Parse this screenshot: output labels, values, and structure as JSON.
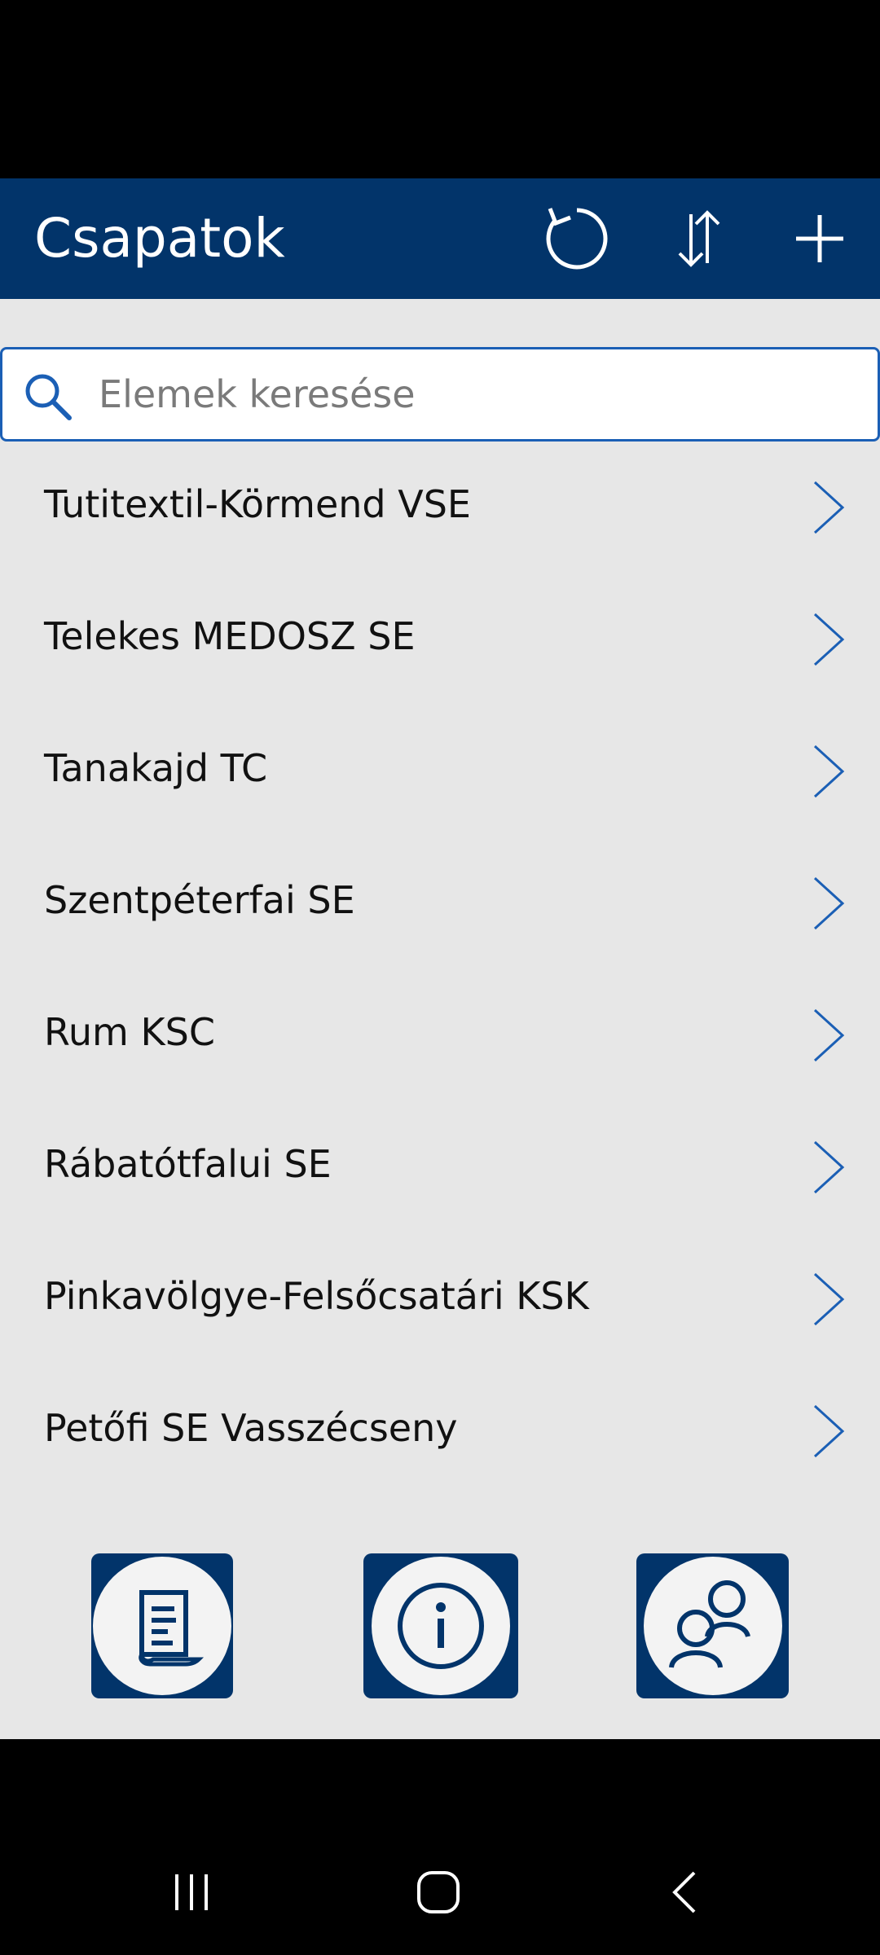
{
  "header": {
    "title": "Csapatok"
  },
  "toolbar": {
    "refresh_icon": "refresh-icon",
    "sort_icon": "sort-icon",
    "add_icon": "add-icon"
  },
  "search": {
    "placeholder": "Elemek keresése",
    "value": ""
  },
  "teams": [
    "Tutitextil-Körmend VSE",
    "Telekes MEDOSZ SE",
    "Tanakajd TC",
    "Szentpéterfai SE",
    "Rum KSC",
    "Rábatótfalui SE",
    "Pinkavölgye-Felsőcsatári KSK",
    "Petőfi SE Vasszécseny"
  ],
  "footer": {
    "icons": [
      "document-icon",
      "info-icon",
      "users-icon"
    ]
  },
  "colors": {
    "header_bg": "#02346a",
    "accent": "#1b5fb5",
    "app_bg": "#e7e7e7"
  }
}
